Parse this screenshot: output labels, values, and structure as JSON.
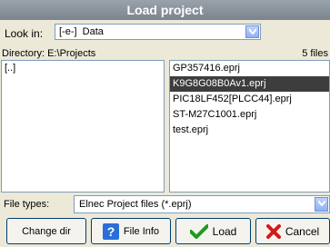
{
  "window": {
    "title": "Load project"
  },
  "lookin": {
    "label": "Look in:",
    "value": "[-e-]  Data"
  },
  "directory": {
    "label": "Directory: E:\\Projects",
    "count": "5 files"
  },
  "dirs": [
    "[..]"
  ],
  "files": [
    {
      "name": "GP357416.eprj",
      "selected": false
    },
    {
      "name": "K9G8G08B0Av1.eprj",
      "selected": true
    },
    {
      "name": "PIC18LF452[PLCC44].eprj",
      "selected": false
    },
    {
      "name": "ST-M27C1001.eprj",
      "selected": false
    },
    {
      "name": "test.eprj",
      "selected": false
    }
  ],
  "filetypes": {
    "label": "File types:",
    "value": "Elnec Project files (*.eprj)"
  },
  "buttons": {
    "change_dir": "Change dir",
    "file_info": "File Info",
    "load": "Load",
    "cancel": "Cancel"
  },
  "colors": {
    "selection": "#3d3d3d",
    "title_bar": "#8a929b",
    "accent": "#2a6fd8"
  },
  "icons": {
    "file_info": "help-icon",
    "load": "check-icon",
    "cancel": "x-icon"
  }
}
